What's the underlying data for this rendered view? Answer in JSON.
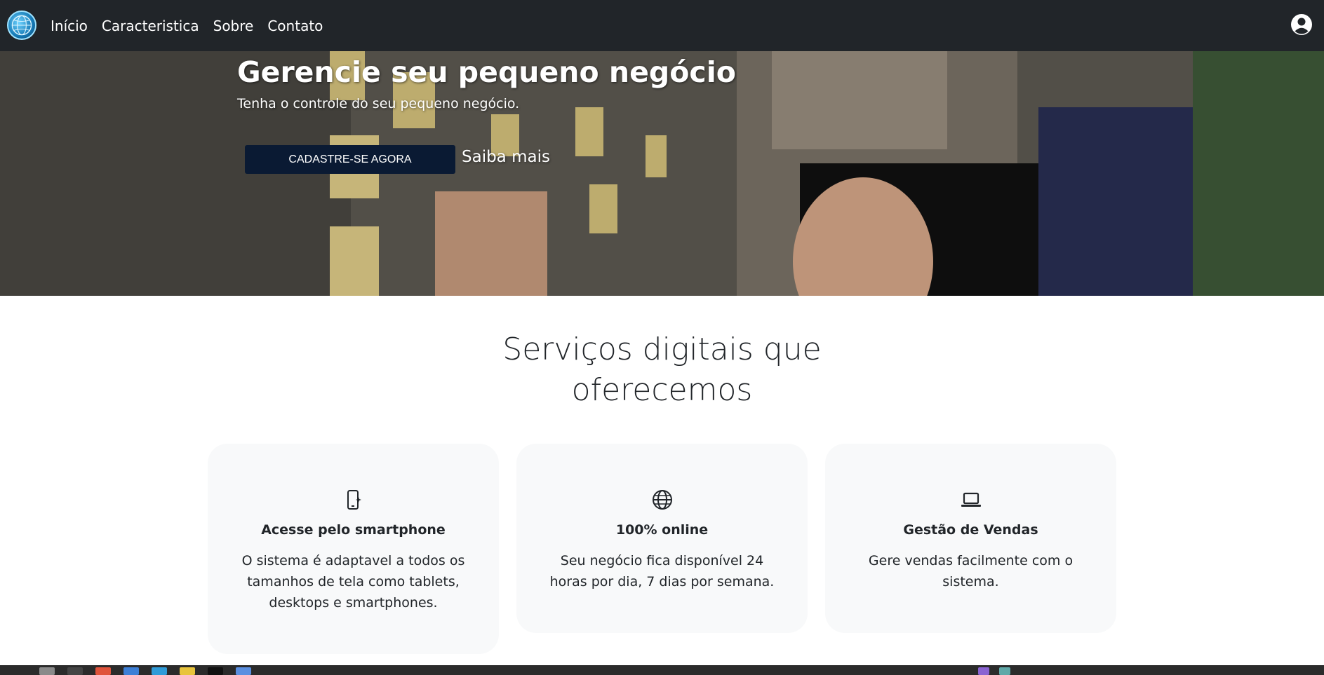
{
  "navbar": {
    "logo_icon": "globe-logo-icon",
    "links": [
      {
        "label": "Início"
      },
      {
        "label": "Caracteristica"
      },
      {
        "label": "Sobre"
      },
      {
        "label": "Contato"
      }
    ],
    "user_icon": "user-circle-icon"
  },
  "hero": {
    "title": "Gerencie seu pequeno negócio",
    "subtitle": "Tenha o controle do seu pequeno negócio.",
    "cta_label": "CADASTRE-SE AGORA",
    "learn_more_label": "Saiba mais"
  },
  "services": {
    "title_line1": "Serviços digitais que",
    "title_line2": "oferecemos",
    "cards": [
      {
        "icon": "smartphone-icon",
        "title": "Acesse pelo smartphone",
        "text": "O sistema é adaptavel a todos os tamanhos de tela como tablets, desktops e smartphones."
      },
      {
        "icon": "globe-icon",
        "title": "100% online",
        "text": "Seu negócio fica disponível 24 horas por dia, 7 dias por semana."
      },
      {
        "icon": "laptop-icon",
        "title": "Gestão de Vendas",
        "text": "Gere vendas facilmente com o sistema."
      }
    ]
  },
  "colors": {
    "navbar_bg": "#212529",
    "cta_bg": "#0a1a33",
    "card_bg": "#f8f9fa"
  }
}
